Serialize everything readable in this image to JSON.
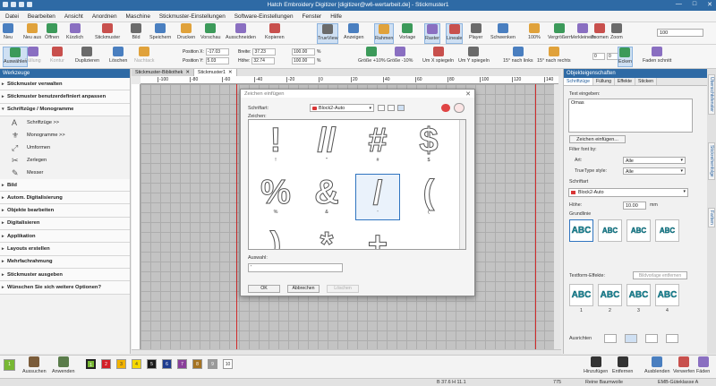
{
  "app": {
    "title": "Hatch Embroidery Digitizer [digitizer@w6-wertarbeit.de] - Stickmuster1",
    "window_buttons": [
      "—",
      "□",
      "✕"
    ]
  },
  "menu": [
    "Datei",
    "Bearbeiten",
    "Ansicht",
    "Anordnen",
    "Maschine",
    "Stickmuster-Einstellungen",
    "Software-Einstellungen",
    "Fenster",
    "Hilfe"
  ],
  "ribbon": {
    "buttons": [
      {
        "label": "Neu",
        "icon": "new-file-icon"
      },
      {
        "label": "Neu aus",
        "icon": "new-from-icon"
      },
      {
        "label": "Öffnen",
        "icon": "open-folder-icon"
      },
      {
        "label": "Kürzlich",
        "icon": "recent-icon"
      },
      {
        "label": "Stickmuster",
        "icon": "design-icon"
      },
      {
        "label": "Bild",
        "icon": "image-icon"
      },
      {
        "label": "Speichern",
        "icon": "save-icon"
      },
      {
        "label": "Drucken",
        "icon": "print-icon"
      },
      {
        "label": "Vorschau",
        "icon": "preview-icon"
      },
      {
        "label": "Ausschneiden",
        "icon": "cut-icon"
      },
      {
        "label": "Kopieren",
        "icon": "copy-icon"
      },
      {
        "label": "TrueView",
        "icon": "trueview-icon"
      },
      {
        "label": "Anzeigen",
        "icon": "eye-icon"
      },
      {
        "label": "Rahmen",
        "icon": "hoop-icon"
      },
      {
        "label": "Vorlage",
        "icon": "template-icon"
      },
      {
        "label": "Raster",
        "icon": "grid-icon"
      },
      {
        "label": "Lineale",
        "icon": "ruler-icon"
      },
      {
        "label": "Player",
        "icon": "player-icon"
      },
      {
        "label": "Schwenken",
        "icon": "pan-icon"
      },
      {
        "label": "100%",
        "icon": "zoom-100-icon"
      },
      {
        "label": "Vergrößern",
        "icon": "zoom-in-icon"
      },
      {
        "label": "Verkleinern",
        "icon": "zoom-out-icon"
      },
      {
        "label": "Zoomen",
        "icon": "zoom-icon"
      },
      {
        "label": "Zoom",
        "icon": "zoom-box-icon"
      }
    ],
    "zoom_value": "100"
  },
  "ribbon2": {
    "buttons": [
      {
        "label": "Auswählen",
        "icon": "select-arrow-icon"
      },
      {
        "label": "Füllung",
        "icon": "fill-icon"
      },
      {
        "label": "Kontur",
        "icon": "outline-icon"
      },
      {
        "label": "Duplizieren",
        "icon": "duplicate-icon"
      },
      {
        "label": "Löschen",
        "icon": "delete-icon"
      },
      {
        "label": "Nachtack",
        "icon": "tieoff-icon"
      },
      {
        "label": "Größe +10%",
        "icon": "scale-up-icon"
      },
      {
        "label": "Größe -10%",
        "icon": "scale-down-icon"
      },
      {
        "label": "Um X spiegeln",
        "icon": "mirror-x-icon"
      },
      {
        "label": "Um Y spiegeln",
        "icon": "mirror-y-icon"
      },
      {
        "label": "15° nach links",
        "icon": "rotate-left-icon"
      },
      {
        "label": "15° nach rechts",
        "icon": "rotate-right-icon"
      },
      {
        "label": "Ecken",
        "icon": "corners-icon"
      },
      {
        "label": "Faden schnitt",
        "icon": "trim-icon"
      }
    ],
    "pos_x_label": "Position X:",
    "pos_x": "-17.03",
    "pos_y_label": "Position Y:",
    "pos_y": "5.03",
    "width_label": "Breite:",
    "width": "37.23",
    "height_label": "Höhe:",
    "height": "32.74",
    "pct1": "100.00",
    "pct2": "100.00",
    "unit": "%",
    "rot1": "0",
    "rot2": "0"
  },
  "left_panel": {
    "title": "Werkzeuge",
    "items_top": [
      "Stickmuster verwalten",
      "Stickmuster benutzerdefiniert anpassen",
      "Schriftzüge / Monogramme"
    ],
    "subitems": [
      {
        "glyph": "A",
        "label": "Schriftzüge >>",
        "icon": "lettering-icon"
      },
      {
        "glyph": "⚜",
        "label": "Monogramme >>",
        "icon": "monogram-icon"
      },
      {
        "glyph": "⤢",
        "label": "Umformen",
        "icon": "reshape-icon"
      },
      {
        "glyph": "✂",
        "label": "Zerlegen",
        "icon": "break-apart-icon"
      },
      {
        "glyph": "✎",
        "label": "Messer",
        "icon": "knife-icon"
      }
    ],
    "items_bottom": [
      "Bild",
      "Autom. Digitalisierung",
      "Objekte bearbeiten",
      "Digitalisieren",
      "Applikation",
      "Layouts erstellen",
      "Mehrfachrahmung",
      "Stickmuster ausgeben",
      "Wünschen Sie sich weitere Optionen?"
    ]
  },
  "tabs": [
    {
      "label": "Stickmuster-Bibliothek",
      "close": "✕"
    },
    {
      "label": "Stickmuster1",
      "close": "✕"
    }
  ],
  "ruler": {
    "h_ticks": [
      "-100",
      "-80",
      "-60",
      "-40",
      "-20",
      "0",
      "20",
      "40",
      "60",
      "80",
      "100",
      "120",
      "140"
    ]
  },
  "dialog": {
    "title": "Zeichen einfügen",
    "close": "✕",
    "font_label": "Schriftart:",
    "font_value": "Block2-Auto",
    "chars_label": "Zeichen:",
    "chars": [
      {
        "glyph": "!",
        "cap": "!"
      },
      {
        "glyph": "//",
        "cap": "\""
      },
      {
        "glyph": "#",
        "cap": "#"
      },
      {
        "glyph": "$",
        "cap": "$"
      },
      {
        "glyph": "%",
        "cap": "%"
      },
      {
        "glyph": "&",
        "cap": "&"
      },
      {
        "glyph": "/",
        "cap": "'"
      },
      {
        "glyph": "(",
        "cap": "("
      },
      {
        "glyph": ")",
        "cap": ""
      },
      {
        "glyph": "*",
        "cap": ""
      },
      {
        "glyph": "+",
        "cap": ""
      },
      {
        "glyph": ",",
        "cap": ""
      }
    ],
    "auswahl_label": "Auswahl:",
    "auswahl_value": "'",
    "ok": "OK",
    "cancel": "Abbrechen",
    "delete": "Löschen"
  },
  "right_panel": {
    "title": "Objekteigenschaften",
    "tabs": [
      "Schriftzüge",
      "Füllung",
      "Effekte",
      "Sticken"
    ],
    "text_label": "Text eingeben:",
    "text_value": "Omas",
    "insert_btn": "Zeichen einfügen...",
    "filter_label": "Filter font by:",
    "art_label": "Art:",
    "art_value": "Alle",
    "truetype_label": "TrueType style:",
    "truetype_value": "Alle",
    "font_label": "Schriftart",
    "font_value": "Block2-Auto",
    "height_label": "Höhe:",
    "height_value": "10.00",
    "height_unit": "mm",
    "baseline_label": "Grundlinie",
    "effects_label": "Textform-Effekte:",
    "effects_btn": "Bildvorlage entfernen",
    "align_label": "Ausrichten",
    "swatch_text": "ABC",
    "swatch_numbers": [
      "1",
      "2",
      "3",
      "4"
    ]
  },
  "right_strip": [
    "Übersichtsfenster",
    "Stickreihenfolge",
    "Farben"
  ],
  "palette": {
    "buttons": [
      {
        "label": "Aussuchen",
        "icon": "pick-color-icon"
      },
      {
        "label": "Anwenden",
        "icon": "apply-color-icon"
      }
    ],
    "chips": [
      {
        "n": "1",
        "color": "#78b833"
      },
      {
        "n": "2",
        "color": "#d21f27"
      },
      {
        "n": "3",
        "color": "#f2b300"
      },
      {
        "n": "4",
        "color": "#f5d800"
      },
      {
        "n": "5",
        "color": "#1a1a1a"
      },
      {
        "n": "6",
        "color": "#1e3c8f"
      },
      {
        "n": "7",
        "color": "#8a3f9a"
      },
      {
        "n": "8",
        "color": "#a57322"
      },
      {
        "n": "9",
        "color": "#9a9a9a"
      },
      {
        "n": "10",
        "color": "#ffffff"
      }
    ],
    "right_buttons": [
      {
        "label": "Hinzufügen",
        "icon": "plus-icon"
      },
      {
        "label": "Entfernen",
        "icon": "minus-icon"
      },
      {
        "label": "Ausblenden",
        "icon": "hide-icon"
      },
      {
        "label": "Verwerfen",
        "icon": "discard-icon"
      },
      {
        "label": "Fäden",
        "icon": "threads-icon"
      }
    ]
  },
  "status": {
    "size": "B 37.6 H 11.1",
    "count": "775",
    "fabric": "Reine Baumwolle",
    "quality": "EMB-Güteklasse A"
  },
  "colors": {
    "accent": "#2e6aa5",
    "hoop_line": "#d12b2b",
    "selection": "#2f74c0"
  }
}
